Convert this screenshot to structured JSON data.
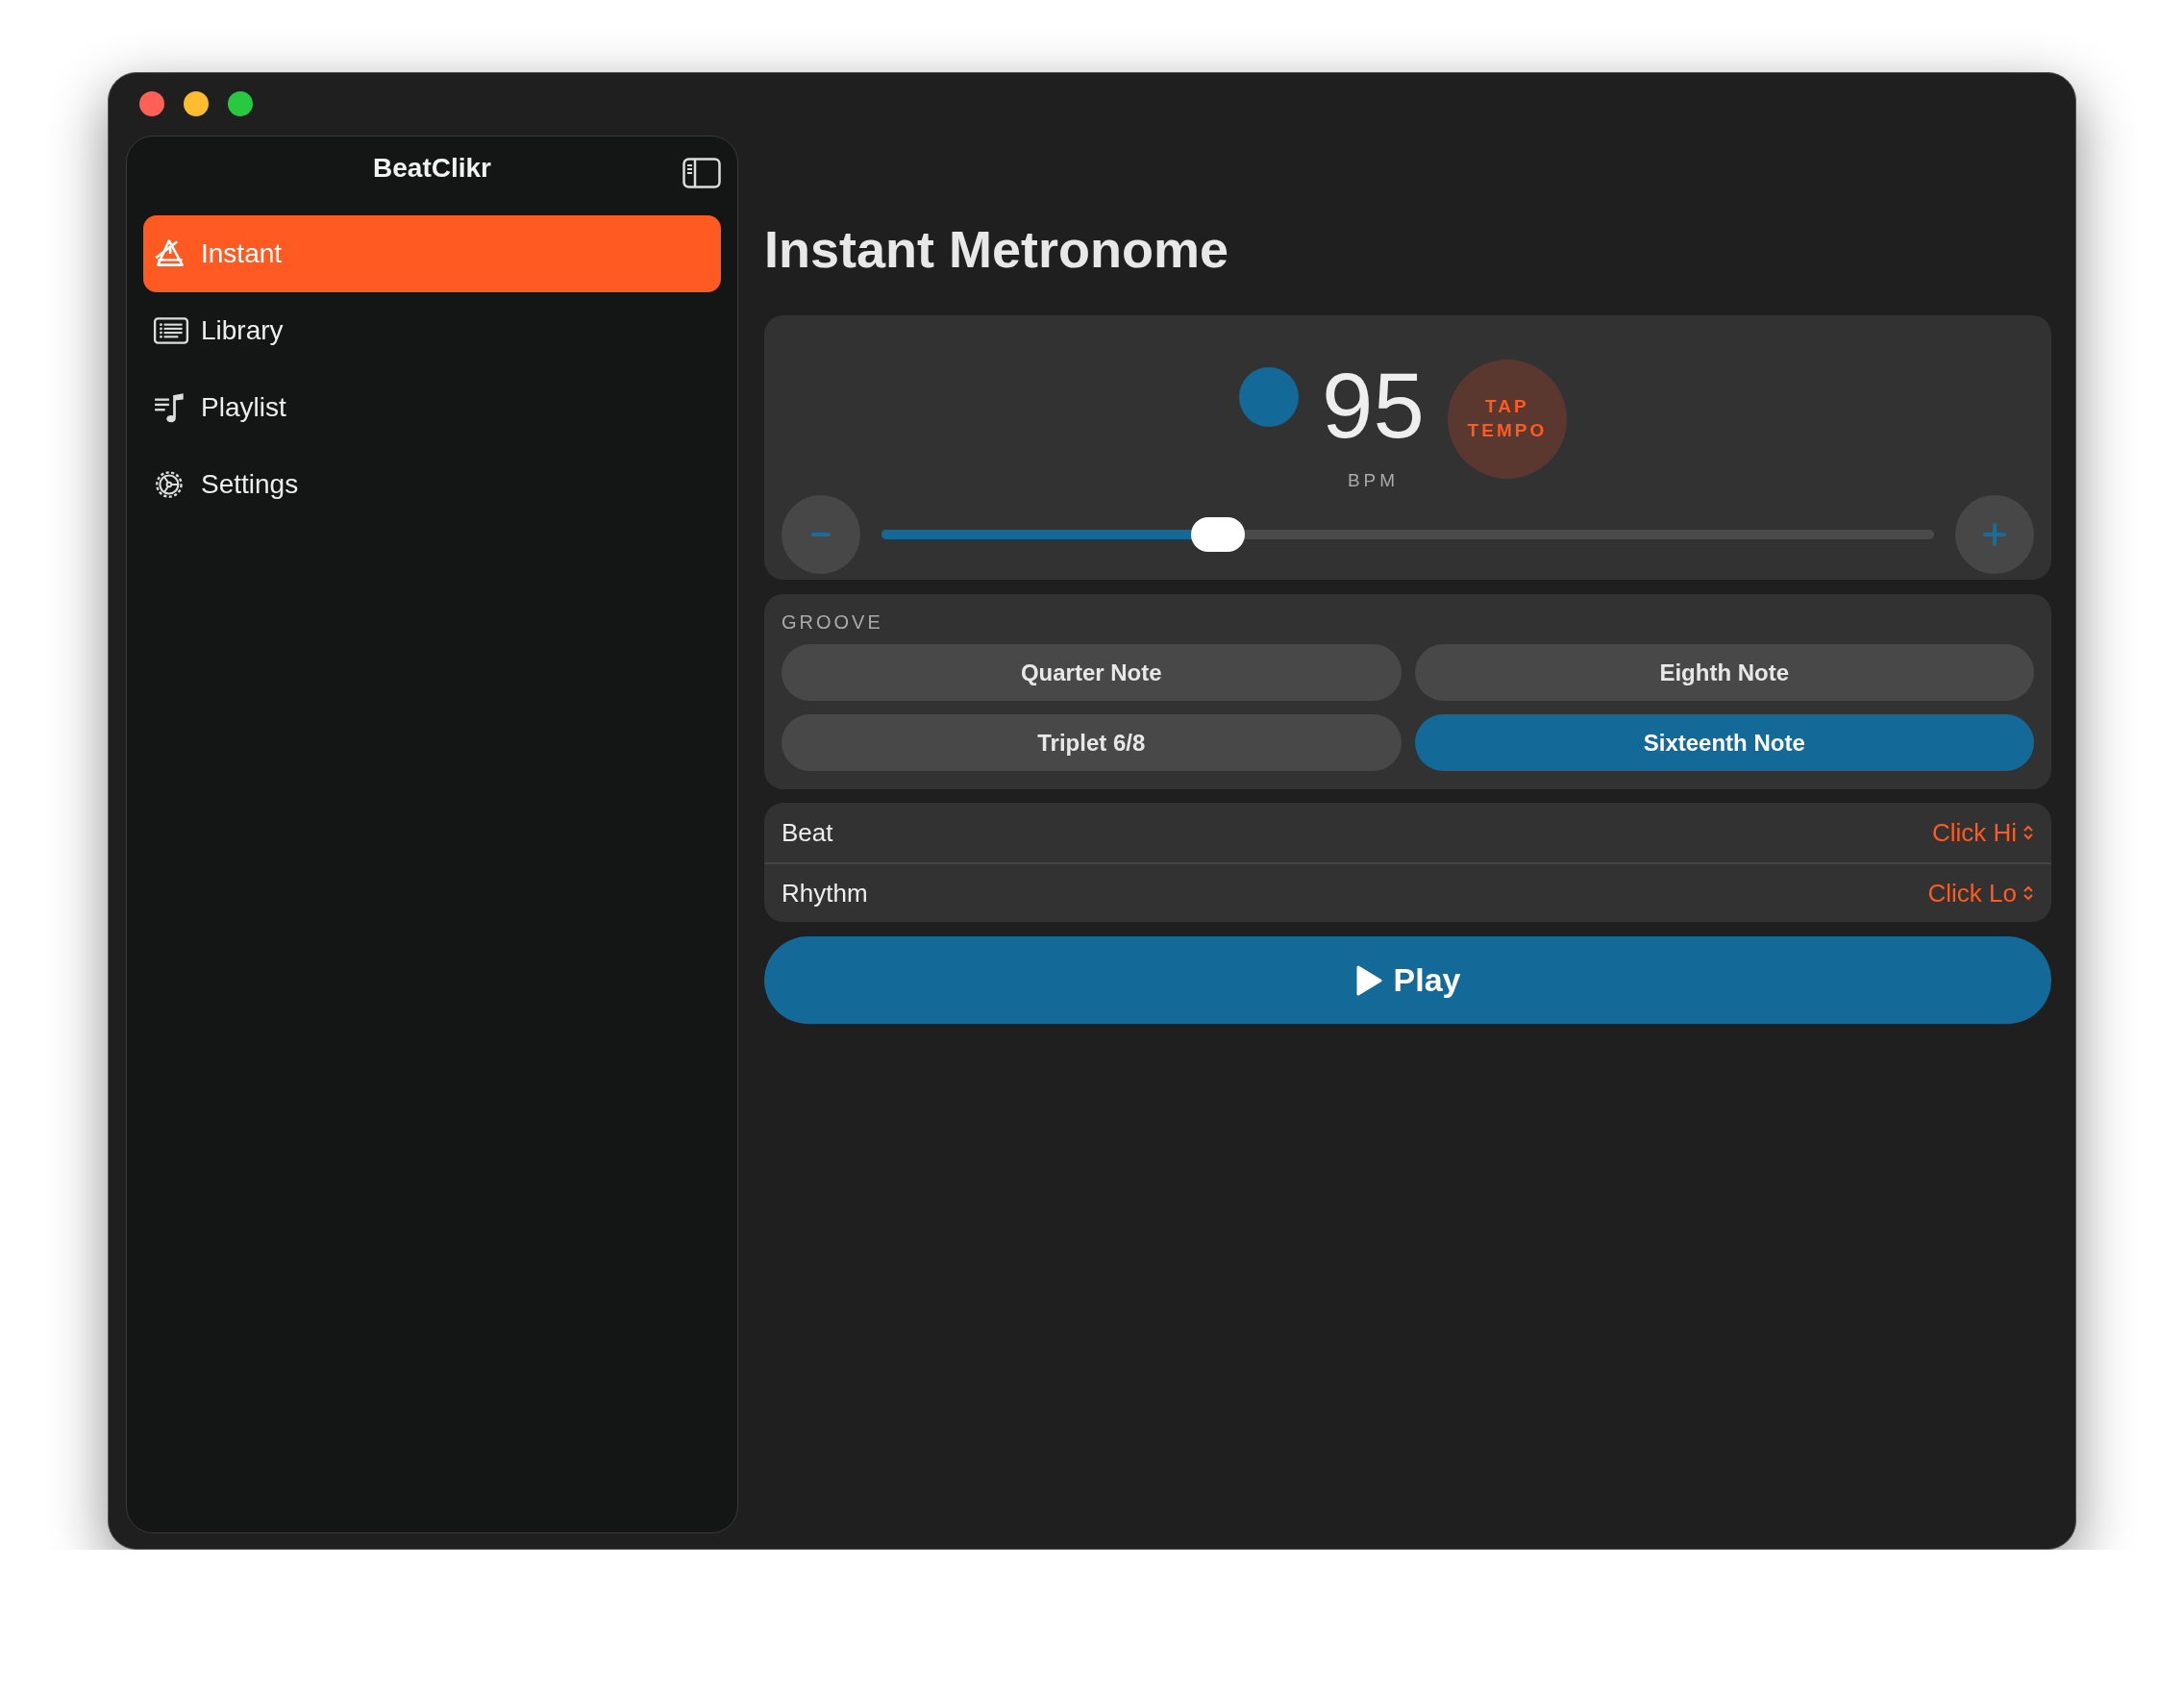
{
  "sidebar": {
    "title": "BeatClikr",
    "items": [
      {
        "label": "Instant",
        "kind": "metronome",
        "selected": true
      },
      {
        "label": "Library",
        "kind": "list",
        "selected": false
      },
      {
        "label": "Playlist",
        "kind": "playlist",
        "selected": false
      },
      {
        "label": "Settings",
        "kind": "gear",
        "selected": false
      }
    ]
  },
  "main": {
    "title": "Instant Metronome"
  },
  "tempo": {
    "value": "95",
    "unit": "BPM",
    "tap_label": "TAP TEMPO",
    "level": 0.32
  },
  "groove": {
    "heading": "GROOVE",
    "options": [
      {
        "label": "Quarter Note",
        "selected": false
      },
      {
        "label": "Eighth Note",
        "selected": false
      },
      {
        "label": "Triplet 6/8",
        "selected": false
      },
      {
        "label": "Sixteenth Note",
        "selected": true
      }
    ]
  },
  "sounds": [
    {
      "label": "Beat",
      "value": "Click Hi"
    },
    {
      "label": "Rhythm",
      "value": "Click Lo"
    }
  ],
  "play": {
    "label": "Play"
  }
}
